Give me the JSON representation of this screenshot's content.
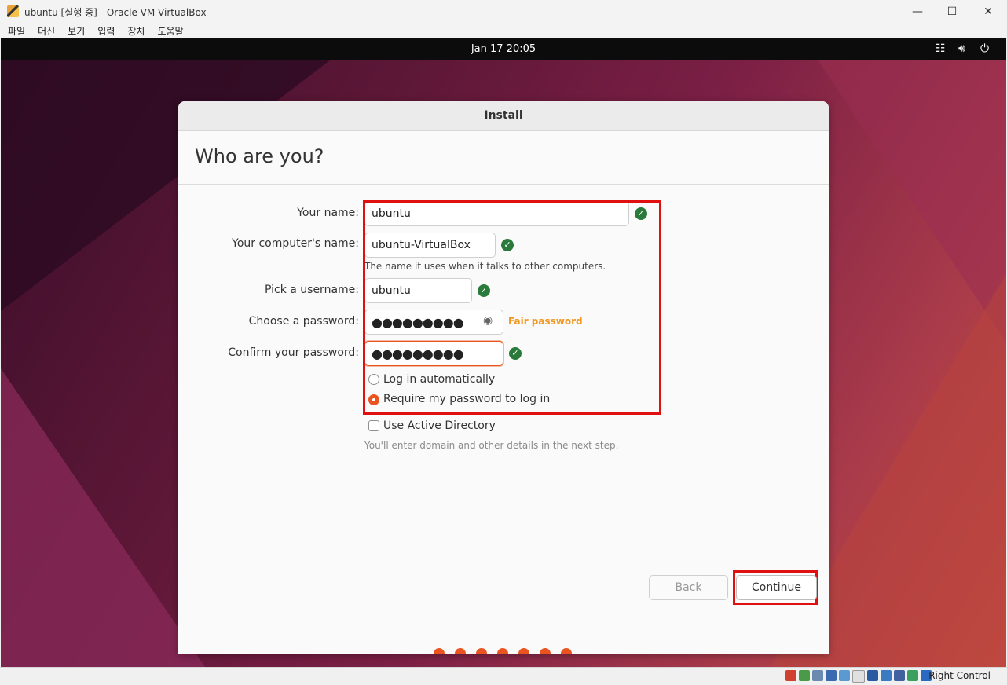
{
  "window": {
    "title": "ubuntu [실행 중] - Oracle VM VirtualBox",
    "minimize": "—",
    "maximize": "☐",
    "close": "✕"
  },
  "menu": [
    "파일",
    "머신",
    "보기",
    "입력",
    "장치",
    "도움말"
  ],
  "guest_topbar": {
    "clock": "Jan 17  20:05",
    "icons": [
      "network-icon",
      "volume-icon",
      "power-icon"
    ]
  },
  "installer": {
    "header": "Install",
    "page_title": "Who are you?",
    "fields": {
      "name": {
        "label": "Your name:",
        "value": "ubuntu"
      },
      "computer": {
        "label": "Your computer's name:",
        "value": "ubuntu-VirtualBox",
        "hint": "The name it uses when it talks to other computers."
      },
      "username": {
        "label": "Pick a username:",
        "value": "ubuntu"
      },
      "password": {
        "label": "Choose a password:",
        "value": "●●●●●●●●●",
        "strength": "Fair password"
      },
      "confirm": {
        "label": "Confirm your password:",
        "value": "●●●●●●●●●"
      }
    },
    "login": {
      "auto_label": "Log in automatically",
      "require_label": "Require my password to log in",
      "selected": "require"
    },
    "active_directory": {
      "label": "Use Active Directory",
      "checked": false,
      "hint": "You'll enter domain and other details in the next step."
    },
    "buttons": {
      "back": "Back",
      "continue": "Continue"
    },
    "progress_steps": 7
  },
  "statusbar": {
    "host_key": "Right Control"
  },
  "colors": {
    "accent": "#e95420",
    "highlight": "#e01010",
    "valid": "#2a7a3b",
    "warning": "#f29822"
  }
}
